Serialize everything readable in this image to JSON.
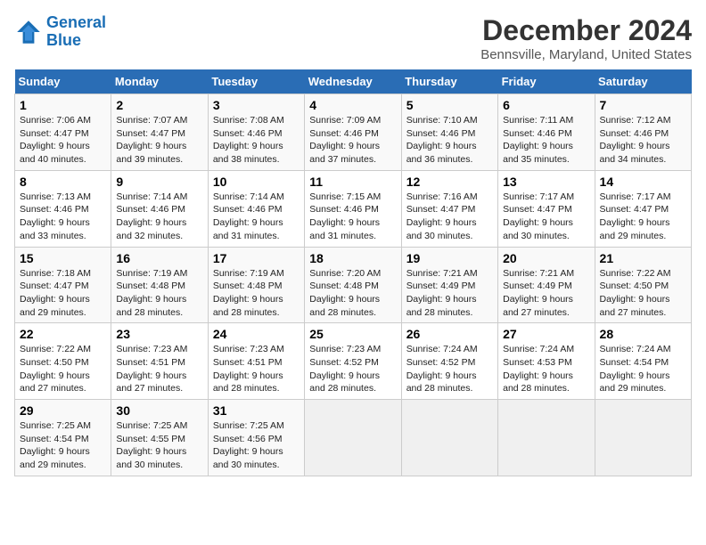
{
  "header": {
    "logo_line1": "General",
    "logo_line2": "Blue",
    "title": "December 2024",
    "subtitle": "Bennsville, Maryland, United States"
  },
  "weekdays": [
    "Sunday",
    "Monday",
    "Tuesday",
    "Wednesday",
    "Thursday",
    "Friday",
    "Saturday"
  ],
  "weeks": [
    [
      {
        "day": "1",
        "sunrise": "Sunrise: 7:06 AM",
        "sunset": "Sunset: 4:47 PM",
        "daylight": "Daylight: 9 hours and 40 minutes."
      },
      {
        "day": "2",
        "sunrise": "Sunrise: 7:07 AM",
        "sunset": "Sunset: 4:47 PM",
        "daylight": "Daylight: 9 hours and 39 minutes."
      },
      {
        "day": "3",
        "sunrise": "Sunrise: 7:08 AM",
        "sunset": "Sunset: 4:46 PM",
        "daylight": "Daylight: 9 hours and 38 minutes."
      },
      {
        "day": "4",
        "sunrise": "Sunrise: 7:09 AM",
        "sunset": "Sunset: 4:46 PM",
        "daylight": "Daylight: 9 hours and 37 minutes."
      },
      {
        "day": "5",
        "sunrise": "Sunrise: 7:10 AM",
        "sunset": "Sunset: 4:46 PM",
        "daylight": "Daylight: 9 hours and 36 minutes."
      },
      {
        "day": "6",
        "sunrise": "Sunrise: 7:11 AM",
        "sunset": "Sunset: 4:46 PM",
        "daylight": "Daylight: 9 hours and 35 minutes."
      },
      {
        "day": "7",
        "sunrise": "Sunrise: 7:12 AM",
        "sunset": "Sunset: 4:46 PM",
        "daylight": "Daylight: 9 hours and 34 minutes."
      }
    ],
    [
      {
        "day": "8",
        "sunrise": "Sunrise: 7:13 AM",
        "sunset": "Sunset: 4:46 PM",
        "daylight": "Daylight: 9 hours and 33 minutes."
      },
      {
        "day": "9",
        "sunrise": "Sunrise: 7:14 AM",
        "sunset": "Sunset: 4:46 PM",
        "daylight": "Daylight: 9 hours and 32 minutes."
      },
      {
        "day": "10",
        "sunrise": "Sunrise: 7:14 AM",
        "sunset": "Sunset: 4:46 PM",
        "daylight": "Daylight: 9 hours and 31 minutes."
      },
      {
        "day": "11",
        "sunrise": "Sunrise: 7:15 AM",
        "sunset": "Sunset: 4:46 PM",
        "daylight": "Daylight: 9 hours and 31 minutes."
      },
      {
        "day": "12",
        "sunrise": "Sunrise: 7:16 AM",
        "sunset": "Sunset: 4:47 PM",
        "daylight": "Daylight: 9 hours and 30 minutes."
      },
      {
        "day": "13",
        "sunrise": "Sunrise: 7:17 AM",
        "sunset": "Sunset: 4:47 PM",
        "daylight": "Daylight: 9 hours and 30 minutes."
      },
      {
        "day": "14",
        "sunrise": "Sunrise: 7:17 AM",
        "sunset": "Sunset: 4:47 PM",
        "daylight": "Daylight: 9 hours and 29 minutes."
      }
    ],
    [
      {
        "day": "15",
        "sunrise": "Sunrise: 7:18 AM",
        "sunset": "Sunset: 4:47 PM",
        "daylight": "Daylight: 9 hours and 29 minutes."
      },
      {
        "day": "16",
        "sunrise": "Sunrise: 7:19 AM",
        "sunset": "Sunset: 4:48 PM",
        "daylight": "Daylight: 9 hours and 28 minutes."
      },
      {
        "day": "17",
        "sunrise": "Sunrise: 7:19 AM",
        "sunset": "Sunset: 4:48 PM",
        "daylight": "Daylight: 9 hours and 28 minutes."
      },
      {
        "day": "18",
        "sunrise": "Sunrise: 7:20 AM",
        "sunset": "Sunset: 4:48 PM",
        "daylight": "Daylight: 9 hours and 28 minutes."
      },
      {
        "day": "19",
        "sunrise": "Sunrise: 7:21 AM",
        "sunset": "Sunset: 4:49 PM",
        "daylight": "Daylight: 9 hours and 28 minutes."
      },
      {
        "day": "20",
        "sunrise": "Sunrise: 7:21 AM",
        "sunset": "Sunset: 4:49 PM",
        "daylight": "Daylight: 9 hours and 27 minutes."
      },
      {
        "day": "21",
        "sunrise": "Sunrise: 7:22 AM",
        "sunset": "Sunset: 4:50 PM",
        "daylight": "Daylight: 9 hours and 27 minutes."
      }
    ],
    [
      {
        "day": "22",
        "sunrise": "Sunrise: 7:22 AM",
        "sunset": "Sunset: 4:50 PM",
        "daylight": "Daylight: 9 hours and 27 minutes."
      },
      {
        "day": "23",
        "sunrise": "Sunrise: 7:23 AM",
        "sunset": "Sunset: 4:51 PM",
        "daylight": "Daylight: 9 hours and 27 minutes."
      },
      {
        "day": "24",
        "sunrise": "Sunrise: 7:23 AM",
        "sunset": "Sunset: 4:51 PM",
        "daylight": "Daylight: 9 hours and 28 minutes."
      },
      {
        "day": "25",
        "sunrise": "Sunrise: 7:23 AM",
        "sunset": "Sunset: 4:52 PM",
        "daylight": "Daylight: 9 hours and 28 minutes."
      },
      {
        "day": "26",
        "sunrise": "Sunrise: 7:24 AM",
        "sunset": "Sunset: 4:52 PM",
        "daylight": "Daylight: 9 hours and 28 minutes."
      },
      {
        "day": "27",
        "sunrise": "Sunrise: 7:24 AM",
        "sunset": "Sunset: 4:53 PM",
        "daylight": "Daylight: 9 hours and 28 minutes."
      },
      {
        "day": "28",
        "sunrise": "Sunrise: 7:24 AM",
        "sunset": "Sunset: 4:54 PM",
        "daylight": "Daylight: 9 hours and 29 minutes."
      }
    ],
    [
      {
        "day": "29",
        "sunrise": "Sunrise: 7:25 AM",
        "sunset": "Sunset: 4:54 PM",
        "daylight": "Daylight: 9 hours and 29 minutes."
      },
      {
        "day": "30",
        "sunrise": "Sunrise: 7:25 AM",
        "sunset": "Sunset: 4:55 PM",
        "daylight": "Daylight: 9 hours and 30 minutes."
      },
      {
        "day": "31",
        "sunrise": "Sunrise: 7:25 AM",
        "sunset": "Sunset: 4:56 PM",
        "daylight": "Daylight: 9 hours and 30 minutes."
      },
      null,
      null,
      null,
      null
    ]
  ]
}
